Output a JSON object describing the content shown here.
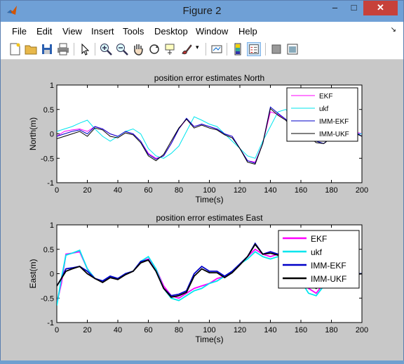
{
  "window": {
    "title": "Figure 2",
    "min_glyph": "–",
    "max_glyph": "□",
    "close_glyph": "✕"
  },
  "menu": [
    "File",
    "Edit",
    "View",
    "Insert",
    "Tools",
    "Desktop",
    "Window",
    "Help"
  ],
  "menu_dock_glyph": "↘",
  "toolbar_icons": [
    "new-figure-icon",
    "open-file-icon",
    "save-icon",
    "print-icon",
    "pointer-icon",
    "zoom-in-icon",
    "zoom-out-icon",
    "pan-hand-icon",
    "rotate-3d-icon",
    "data-cursor-icon",
    "brush-icon",
    "brush-dropdown-icon",
    "link-plot-icon",
    "colorbar-icon",
    "legend-icon",
    "hide-plot-tools-icon",
    "show-plot-tools-icon"
  ],
  "colors": {
    "EKF": "#ff00ff",
    "ukf": "#00e5ee",
    "IMM-EKF": "#0000c8",
    "IMM-UKF": "#000000"
  },
  "chart_data": [
    {
      "type": "line",
      "title": "position error estimates North",
      "xlabel": "Time(s)",
      "ylabel": "North(m)",
      "xlim": [
        0,
        200
      ],
      "ylim": [
        -1,
        1
      ],
      "xticks": [
        0,
        20,
        40,
        60,
        80,
        100,
        120,
        140,
        160,
        180,
        200
      ],
      "yticks": [
        -1,
        -0.5,
        0,
        0.5,
        1
      ],
      "legend_position": "top-right",
      "series": [
        {
          "name": "EKF",
          "color": "#ff00ff",
          "x": [
            0,
            5,
            10,
            15,
            20,
            25,
            30,
            35,
            40,
            45,
            50,
            55,
            60,
            65,
            70,
            75,
            80,
            85,
            90,
            95,
            100,
            105,
            110,
            115,
            120,
            125,
            130,
            135,
            140,
            145,
            150,
            155,
            160,
            165,
            170,
            175,
            180,
            185,
            190,
            195,
            200
          ],
          "y": [
            -0.05,
            0.05,
            0.08,
            0.1,
            0.05,
            0.15,
            0.1,
            0.0,
            -0.05,
            0.05,
            0.0,
            -0.15,
            -0.4,
            -0.5,
            -0.45,
            -0.2,
            0.1,
            0.3,
            0.15,
            0.2,
            0.15,
            0.1,
            0.0,
            -0.05,
            -0.3,
            -0.55,
            -0.58,
            -0.2,
            0.45,
            0.4,
            0.3,
            0.1,
            -0.05,
            0.0,
            -0.1,
            -0.15,
            -0.05,
            0.0,
            0.05,
            0.05,
            0.0
          ]
        },
        {
          "name": "ukf",
          "color": "#00e5ee",
          "x": [
            0,
            5,
            10,
            15,
            20,
            25,
            30,
            35,
            40,
            45,
            50,
            55,
            60,
            65,
            70,
            75,
            80,
            85,
            90,
            95,
            100,
            105,
            110,
            115,
            120,
            125,
            130,
            135,
            140,
            145,
            150,
            155,
            160,
            165,
            170,
            175,
            180,
            185,
            190,
            195,
            200
          ],
          "y": [
            0.05,
            0.1,
            0.15,
            0.22,
            0.28,
            0.1,
            -0.05,
            -0.15,
            -0.05,
            0.05,
            0.1,
            0.0,
            -0.3,
            -0.45,
            -0.5,
            -0.4,
            -0.25,
            0.05,
            0.35,
            0.28,
            0.2,
            0.15,
            0.0,
            -0.15,
            -0.3,
            -0.45,
            -0.5,
            -0.15,
            0.15,
            0.45,
            0.5,
            0.35,
            0.15,
            0.0,
            -0.05,
            -0.05,
            0.0,
            0.0,
            0.05,
            0.0,
            0.0
          ]
        },
        {
          "name": "IMM-EKF",
          "color": "#0000c8",
          "x": [
            0,
            5,
            10,
            15,
            20,
            25,
            30,
            35,
            40,
            45,
            50,
            55,
            60,
            65,
            70,
            75,
            80,
            85,
            90,
            95,
            100,
            105,
            110,
            115,
            120,
            125,
            130,
            135,
            140,
            145,
            150,
            155,
            160,
            165,
            170,
            175,
            180,
            185,
            190,
            195,
            200
          ],
          "y": [
            -0.05,
            0.0,
            0.05,
            0.08,
            0.0,
            0.15,
            0.1,
            0.0,
            -0.05,
            0.05,
            0.0,
            -0.15,
            -0.42,
            -0.52,
            -0.45,
            -0.2,
            0.1,
            0.32,
            0.15,
            0.2,
            0.15,
            0.1,
            0.0,
            -0.05,
            -0.3,
            -0.55,
            -0.6,
            -0.2,
            0.55,
            0.42,
            0.3,
            0.1,
            -0.1,
            0.0,
            -0.15,
            -0.2,
            -0.05,
            0.05,
            0.08,
            0.05,
            -0.05
          ]
        },
        {
          "name": "IMM-UKF",
          "color": "#000000",
          "x": [
            0,
            5,
            10,
            15,
            20,
            25,
            30,
            35,
            40,
            45,
            50,
            55,
            60,
            65,
            70,
            75,
            80,
            85,
            90,
            95,
            100,
            105,
            110,
            115,
            120,
            125,
            130,
            135,
            140,
            145,
            150,
            155,
            160,
            165,
            170,
            175,
            180,
            185,
            190,
            195,
            200
          ],
          "y": [
            -0.1,
            -0.05,
            0.0,
            0.05,
            -0.05,
            0.12,
            0.08,
            -0.05,
            -0.08,
            0.02,
            -0.02,
            -0.18,
            -0.45,
            -0.55,
            -0.42,
            -0.15,
            0.12,
            0.3,
            0.12,
            0.18,
            0.12,
            0.08,
            -0.02,
            -0.08,
            -0.3,
            -0.58,
            -0.62,
            -0.2,
            0.52,
            0.38,
            0.28,
            0.08,
            -0.12,
            -0.05,
            -0.18,
            -0.2,
            -0.08,
            0.02,
            0.05,
            0.02,
            -0.05
          ]
        }
      ]
    },
    {
      "type": "line",
      "title": "position error estimates East",
      "xlabel": "Time(s)",
      "ylabel": "East(m)",
      "xlim": [
        0,
        200
      ],
      "ylim": [
        -1,
        1
      ],
      "xticks": [
        0,
        20,
        40,
        60,
        80,
        100,
        120,
        140,
        160,
        180,
        200
      ],
      "yticks": [
        -1,
        -0.5,
        0,
        0.5,
        1
      ],
      "legend_position": "top-right",
      "series": [
        {
          "name": "EKF",
          "color": "#ff00ff",
          "x": [
            0,
            3,
            6,
            10,
            15,
            20,
            25,
            30,
            35,
            40,
            45,
            50,
            55,
            60,
            65,
            70,
            75,
            80,
            85,
            90,
            95,
            100,
            105,
            110,
            115,
            120,
            125,
            130,
            135,
            140,
            145,
            150,
            155,
            160,
            165,
            170,
            175,
            180,
            185,
            190,
            195,
            200
          ],
          "y": [
            -0.6,
            -0.2,
            0.4,
            0.42,
            0.45,
            0.1,
            -0.1,
            -0.15,
            -0.05,
            -0.1,
            0.0,
            0.05,
            0.25,
            0.3,
            0.1,
            -0.25,
            -0.45,
            -0.5,
            -0.4,
            -0.3,
            -0.25,
            -0.2,
            -0.1,
            -0.05,
            0.05,
            0.2,
            0.35,
            0.5,
            0.4,
            0.35,
            0.4,
            0.3,
            0.1,
            -0.1,
            -0.3,
            -0.4,
            -0.2,
            -0.1,
            -0.05,
            0.0,
            0.0,
            0.0
          ]
        },
        {
          "name": "ukf",
          "color": "#00e5ee",
          "x": [
            0,
            3,
            6,
            10,
            15,
            20,
            25,
            30,
            35,
            40,
            45,
            50,
            55,
            60,
            65,
            70,
            75,
            80,
            85,
            90,
            95,
            100,
            105,
            110,
            115,
            120,
            125,
            130,
            135,
            140,
            145,
            150,
            155,
            160,
            165,
            170,
            175,
            180,
            185,
            190,
            195,
            200
          ],
          "y": [
            -0.65,
            -0.1,
            0.38,
            0.42,
            0.48,
            0.1,
            -0.1,
            -0.15,
            -0.05,
            -0.1,
            0.0,
            0.05,
            0.25,
            0.35,
            0.1,
            -0.3,
            -0.5,
            -0.55,
            -0.45,
            -0.35,
            -0.3,
            -0.2,
            -0.15,
            -0.05,
            0.05,
            0.2,
            0.3,
            0.45,
            0.35,
            0.3,
            0.35,
            0.25,
            0.05,
            -0.15,
            -0.4,
            -0.45,
            -0.25,
            -0.1,
            -0.05,
            0.0,
            0.0,
            0.0
          ]
        },
        {
          "name": "IMM-EKF",
          "color": "#0000c8",
          "x": [
            0,
            3,
            6,
            10,
            15,
            20,
            25,
            30,
            35,
            40,
            45,
            50,
            55,
            60,
            65,
            70,
            75,
            80,
            85,
            90,
            95,
            100,
            105,
            110,
            115,
            120,
            125,
            130,
            135,
            140,
            145,
            150,
            155,
            160,
            165,
            170,
            175,
            180,
            185,
            190,
            195,
            200
          ],
          "y": [
            -0.25,
            -0.1,
            0.1,
            0.12,
            0.15,
            0.05,
            -0.1,
            -0.15,
            -0.05,
            -0.1,
            0.0,
            0.05,
            0.25,
            0.28,
            0.05,
            -0.3,
            -0.45,
            -0.42,
            -0.35,
            0.0,
            0.15,
            0.05,
            0.05,
            -0.05,
            0.05,
            0.2,
            0.35,
            0.62,
            0.4,
            0.45,
            0.4,
            0.3,
            0.1,
            -0.1,
            -0.2,
            -0.3,
            -0.15,
            -0.1,
            -0.05,
            0.0,
            0.0,
            0.0
          ]
        },
        {
          "name": "IMM-UKF",
          "color": "#000000",
          "x": [
            0,
            3,
            6,
            10,
            15,
            20,
            25,
            30,
            35,
            40,
            45,
            50,
            55,
            60,
            65,
            70,
            75,
            80,
            85,
            90,
            95,
            100,
            105,
            110,
            115,
            120,
            125,
            130,
            135,
            140,
            145,
            150,
            155,
            160,
            165,
            170,
            175,
            180,
            185,
            190,
            195,
            200
          ],
          "y": [
            -0.25,
            -0.1,
            0.05,
            0.1,
            0.15,
            0.0,
            -0.1,
            -0.18,
            -0.08,
            -0.12,
            -0.02,
            0.05,
            0.22,
            0.28,
            0.05,
            -0.3,
            -0.48,
            -0.45,
            -0.38,
            -0.05,
            0.1,
            0.02,
            0.02,
            -0.08,
            0.02,
            0.18,
            0.35,
            0.6,
            0.4,
            0.42,
            0.38,
            0.28,
            0.08,
            -0.12,
            -0.2,
            -0.3,
            -0.18,
            -0.12,
            -0.08,
            -0.02,
            -0.02,
            0.0
          ]
        }
      ]
    }
  ]
}
